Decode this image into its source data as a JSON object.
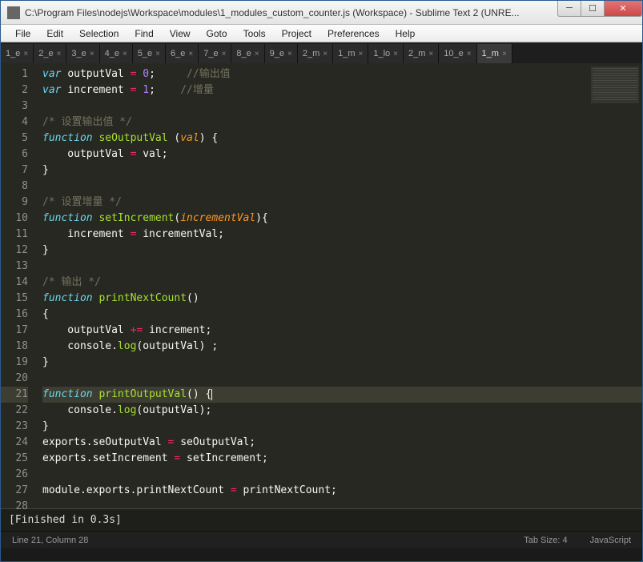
{
  "window": {
    "title": "C:\\Program Files\\nodejs\\Workspace\\modules\\1_modules_custom_counter.js (Workspace) - Sublime Text 2 (UNRE..."
  },
  "menu": {
    "items": [
      "File",
      "Edit",
      "Selection",
      "Find",
      "View",
      "Goto",
      "Tools",
      "Project",
      "Preferences",
      "Help"
    ]
  },
  "tabs": [
    {
      "label": "1_e",
      "active": false
    },
    {
      "label": "2_e",
      "active": false
    },
    {
      "label": "3_e",
      "active": false
    },
    {
      "label": "4_e",
      "active": false
    },
    {
      "label": "5_e",
      "active": false
    },
    {
      "label": "6_e",
      "active": false
    },
    {
      "label": "7_e",
      "active": false
    },
    {
      "label": "8_e",
      "active": false
    },
    {
      "label": "9_e",
      "active": false
    },
    {
      "label": "2_m",
      "active": false
    },
    {
      "label": "1_m",
      "active": false
    },
    {
      "label": "1_lo",
      "active": false
    },
    {
      "label": "2_m",
      "active": false
    },
    {
      "label": "10_e",
      "active": false
    },
    {
      "label": "1_m",
      "active": true
    }
  ],
  "code_lines": [
    [
      {
        "t": "var ",
        "c": "kw"
      },
      {
        "t": "outputVal ",
        "c": "id"
      },
      {
        "t": "= ",
        "c": "op"
      },
      {
        "t": "0",
        "c": "num"
      },
      {
        "t": ";     ",
        "c": "id"
      },
      {
        "t": "//输出值",
        "c": "cm"
      }
    ],
    [
      {
        "t": "var ",
        "c": "kw"
      },
      {
        "t": "increment ",
        "c": "id"
      },
      {
        "t": "= ",
        "c": "op"
      },
      {
        "t": "1",
        "c": "num"
      },
      {
        "t": ";    ",
        "c": "id"
      },
      {
        "t": "//增量",
        "c": "cm"
      }
    ],
    [],
    [
      {
        "t": "/* 设置输出值 */",
        "c": "cm"
      }
    ],
    [
      {
        "t": "function ",
        "c": "kw"
      },
      {
        "t": "seOutputVal ",
        "c": "fn"
      },
      {
        "t": "(",
        "c": "id"
      },
      {
        "t": "val",
        "c": "arg"
      },
      {
        "t": ") {",
        "c": "id"
      }
    ],
    [
      {
        "t": "    outputVal ",
        "c": "id"
      },
      {
        "t": "= ",
        "c": "op"
      },
      {
        "t": "val;",
        "c": "id"
      }
    ],
    [
      {
        "t": "}",
        "c": "id"
      }
    ],
    [],
    [
      {
        "t": "/* 设置增量 */",
        "c": "cm"
      }
    ],
    [
      {
        "t": "function ",
        "c": "kw"
      },
      {
        "t": "setIncrement",
        "c": "fn"
      },
      {
        "t": "(",
        "c": "id"
      },
      {
        "t": "incrementVal",
        "c": "arg"
      },
      {
        "t": "){",
        "c": "id"
      }
    ],
    [
      {
        "t": "    increment ",
        "c": "id"
      },
      {
        "t": "= ",
        "c": "op"
      },
      {
        "t": "incrementVal;",
        "c": "id"
      }
    ],
    [
      {
        "t": "}",
        "c": "id"
      }
    ],
    [],
    [
      {
        "t": "/* 输出 */",
        "c": "cm"
      }
    ],
    [
      {
        "t": "function ",
        "c": "kw"
      },
      {
        "t": "printNextCount",
        "c": "fn"
      },
      {
        "t": "()",
        "c": "id"
      }
    ],
    [
      {
        "t": "{",
        "c": "id"
      }
    ],
    [
      {
        "t": "    outputVal ",
        "c": "id"
      },
      {
        "t": "+= ",
        "c": "op"
      },
      {
        "t": "increment;",
        "c": "id"
      }
    ],
    [
      {
        "t": "    console.",
        "c": "id"
      },
      {
        "t": "log",
        "c": "fn"
      },
      {
        "t": "(outputVal) ;",
        "c": "id"
      }
    ],
    [
      {
        "t": "}",
        "c": "id"
      }
    ],
    [],
    [
      {
        "t": "function ",
        "c": "kw"
      },
      {
        "t": "printOutputVal",
        "c": "fn"
      },
      {
        "t": "() {",
        "c": "id"
      },
      {
        "t": "|",
        "c": "caret-marker"
      }
    ],
    [
      {
        "t": "    console.",
        "c": "id"
      },
      {
        "t": "log",
        "c": "fn"
      },
      {
        "t": "(outputVal);",
        "c": "id"
      }
    ],
    [
      {
        "t": "}",
        "c": "id"
      }
    ],
    [
      {
        "t": "exports.seOutputVal ",
        "c": "id"
      },
      {
        "t": "= ",
        "c": "op"
      },
      {
        "t": "seOutputVal;",
        "c": "id"
      }
    ],
    [
      {
        "t": "exports.setIncrement ",
        "c": "id"
      },
      {
        "t": "= ",
        "c": "op"
      },
      {
        "t": "setIncrement;",
        "c": "id"
      }
    ],
    [],
    [
      {
        "t": "module.exports.printNextCount ",
        "c": "id"
      },
      {
        "t": "= ",
        "c": "op"
      },
      {
        "t": "printNextCount;",
        "c": "id"
      }
    ],
    []
  ],
  "highlighted_line": 21,
  "console": {
    "output": "[Finished in 0.3s]"
  },
  "status": {
    "cursor": "Line 21, Column 28",
    "tab_size": "Tab Size: 4",
    "syntax": "JavaScript"
  }
}
